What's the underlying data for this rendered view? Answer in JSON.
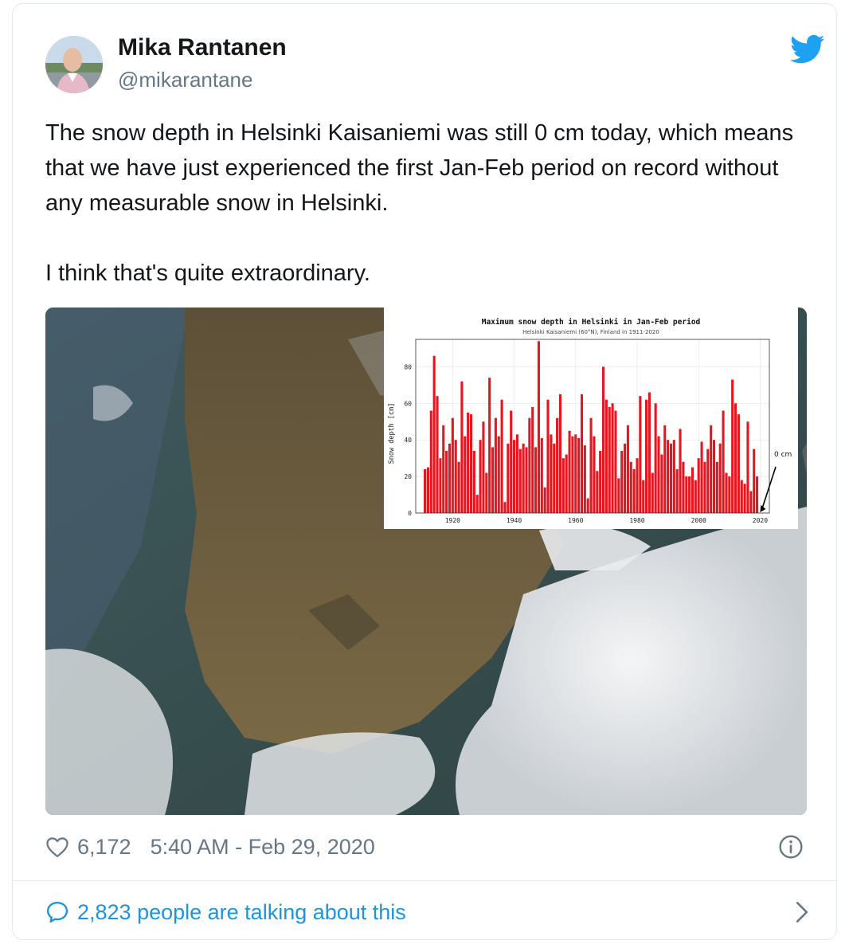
{
  "tweet": {
    "author_name": "Mika Rantanen",
    "author_handle": "@mikarantane",
    "paragraphs": [
      "The snow depth in Helsinki Kaisaniemi was still 0 cm today, which means that we have just experienced the first Jan-Feb period on record without any measurable snow in Helsinki.",
      "I think that's quite extraordinary."
    ],
    "likes": "6,172",
    "timestamp": "5:40 AM - Feb 29, 2020",
    "talking": "2,823 people are talking about this"
  },
  "colors": {
    "link_blue": "#1b95e0",
    "muted_gray": "#657786",
    "bar_red": "#e8141e"
  },
  "icons": {
    "brand": "twitter-bird-icon",
    "like": "heart-icon",
    "info": "info-icon",
    "reply": "speech-bubble-icon",
    "more": "chevron-right-icon"
  },
  "chart_data": {
    "type": "bar",
    "title": "Maximum snow depth in Helsinki in Jan-Feb period",
    "subtitle": "Helsinki Kaisaniemi (60°N), Finland in 1911-2020",
    "xlabel": "",
    "ylabel": "Snow depth [cm]",
    "ylim": [
      0,
      95
    ],
    "xlim": [
      1908,
      2023
    ],
    "yticks": [
      0,
      20,
      40,
      60,
      80
    ],
    "xticks": [
      1920,
      1940,
      1960,
      1980,
      2000,
      2020
    ],
    "annotation": "0 cm",
    "annotation_year": 2020,
    "x": [
      1911,
      1912,
      1913,
      1914,
      1915,
      1916,
      1917,
      1918,
      1919,
      1920,
      1921,
      1922,
      1923,
      1924,
      1925,
      1926,
      1927,
      1928,
      1929,
      1930,
      1931,
      1932,
      1933,
      1934,
      1935,
      1936,
      1937,
      1938,
      1939,
      1940,
      1941,
      1942,
      1943,
      1944,
      1945,
      1946,
      1947,
      1948,
      1949,
      1950,
      1951,
      1952,
      1953,
      1954,
      1955,
      1956,
      1957,
      1958,
      1959,
      1960,
      1961,
      1962,
      1963,
      1964,
      1965,
      1966,
      1967,
      1968,
      1969,
      1970,
      1971,
      1972,
      1973,
      1974,
      1975,
      1976,
      1977,
      1978,
      1979,
      1980,
      1981,
      1982,
      1983,
      1984,
      1985,
      1986,
      1987,
      1988,
      1989,
      1990,
      1991,
      1992,
      1993,
      1994,
      1995,
      1996,
      1997,
      1998,
      1999,
      2000,
      2001,
      2002,
      2003,
      2004,
      2005,
      2006,
      2007,
      2008,
      2009,
      2010,
      2011,
      2012,
      2013,
      2014,
      2015,
      2016,
      2017,
      2018,
      2019,
      2020
    ],
    "values": [
      24,
      25,
      56,
      86,
      64,
      30,
      48,
      34,
      38,
      52,
      40,
      28,
      72,
      42,
      55,
      54,
      34,
      10,
      40,
      50,
      22,
      74,
      36,
      52,
      42,
      62,
      6,
      38,
      56,
      40,
      43,
      35,
      38,
      36,
      52,
      58,
      36,
      94,
      41,
      14,
      62,
      43,
      38,
      52,
      65,
      30,
      32,
      45,
      42,
      43,
      41,
      65,
      37,
      8,
      52,
      42,
      23,
      34,
      80,
      62,
      58,
      60,
      56,
      19,
      34,
      38,
      48,
      28,
      24,
      30,
      64,
      18,
      62,
      66,
      22,
      60,
      42,
      32,
      48,
      40,
      38,
      40,
      24,
      46,
      28,
      20,
      20,
      25,
      18,
      30,
      39,
      28,
      35,
      48,
      40,
      28,
      38,
      56,
      22,
      20,
      73,
      60,
      54,
      18,
      16,
      50,
      12,
      35,
      20,
      0
    ]
  }
}
